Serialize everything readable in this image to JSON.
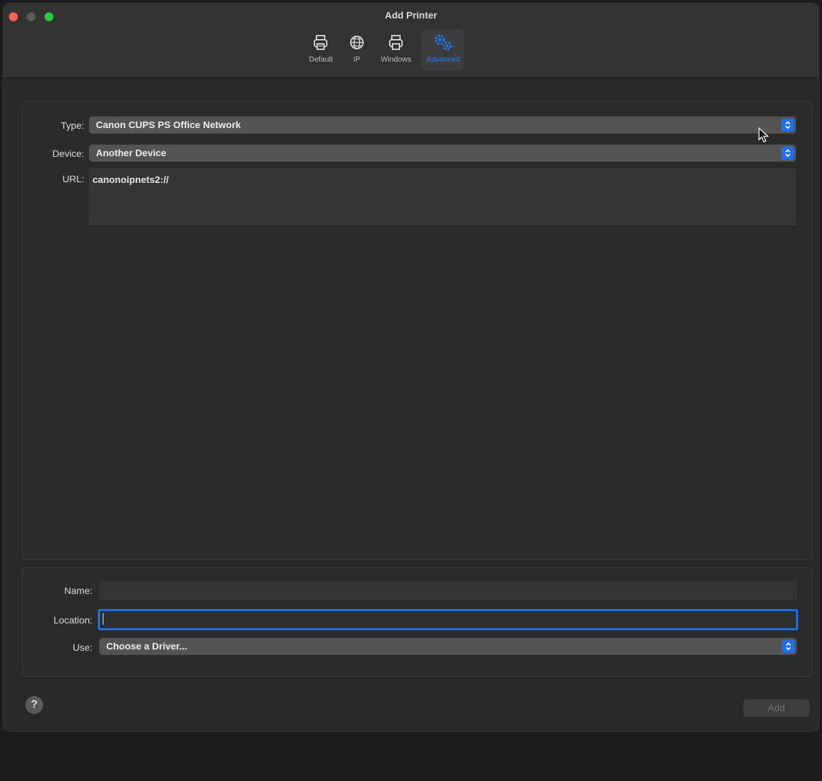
{
  "window": {
    "title": "Add Printer"
  },
  "toolbar": {
    "items": [
      {
        "label": "Default",
        "icon": "printer-icon"
      },
      {
        "label": "IP",
        "icon": "globe-icon"
      },
      {
        "label": "Windows",
        "icon": "printer-icon"
      },
      {
        "label": "Advanced",
        "icon": "gears-icon",
        "active": true
      }
    ]
  },
  "form": {
    "type_label": "Type:",
    "type_value": "Canon CUPS PS Office Network",
    "device_label": "Device:",
    "device_value": "Another Device",
    "url_label": "URL:",
    "url_value": "canonoipnets2://"
  },
  "details": {
    "name_label": "Name:",
    "name_value": "",
    "location_label": "Location:",
    "location_value": "",
    "use_label": "Use:",
    "use_value": "Choose a Driver..."
  },
  "footer": {
    "help_label": "?",
    "add_label": "Add"
  },
  "colors": {
    "accent": "#1f6fe8",
    "close": "#ff5f57",
    "zoom": "#28c840"
  }
}
